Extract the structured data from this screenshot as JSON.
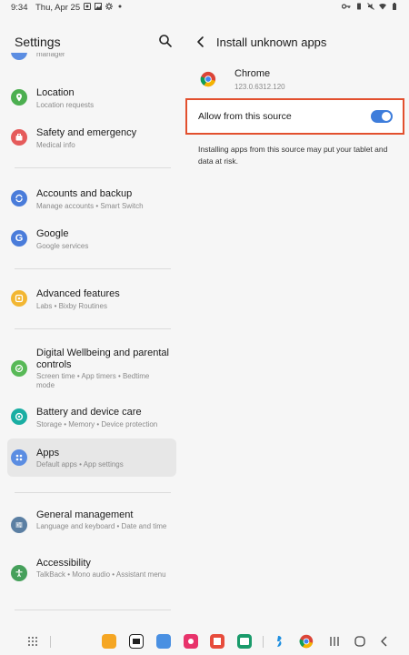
{
  "status_bar": {
    "time": "9:34",
    "date": "Thu, Apr 25"
  },
  "left": {
    "title": "Settings",
    "top_partial_sub": "manager",
    "items": [
      {
        "title": "Location",
        "sub": "Location requests",
        "icon": "location-icon",
        "color": "#4caf50"
      },
      {
        "title": "Safety and emergency",
        "sub": "Medical info",
        "icon": "safety-icon",
        "color": "#e55b5b"
      },
      {
        "title": "Accounts and backup",
        "sub": "Manage accounts  •  Smart Switch",
        "icon": "sync-icon",
        "color": "#4a7cda"
      },
      {
        "title": "Google",
        "sub": "Google services",
        "icon": "google-icon",
        "color": "#4a7cda"
      },
      {
        "title": "Advanced features",
        "sub": "Labs  •  Bixby Routines",
        "icon": "advanced-features-icon",
        "color": "#f2b632"
      },
      {
        "title": "Digital Wellbeing and parental controls",
        "sub": "Screen time  •  App timers  •  Bedtime mode",
        "icon": "wellbeing-icon",
        "color": "#58b957"
      },
      {
        "title": "Battery and device care",
        "sub": "Storage  •  Memory  •  Device protection",
        "icon": "device-care-icon",
        "color": "#1aaea3"
      },
      {
        "title": "Apps",
        "sub": "Default apps  •  App settings",
        "icon": "apps-icon",
        "color": "#5b8de2"
      },
      {
        "title": "General management",
        "sub": "Language and keyboard  •  Date and time",
        "icon": "general-management-icon",
        "color": "#5b7fa3"
      },
      {
        "title": "Accessibility",
        "sub": "TalkBack  •  Mono audio  •  Assistant menu",
        "icon": "accessibility-icon",
        "color": "#46a05b"
      }
    ]
  },
  "right": {
    "title": "Install unknown apps",
    "app_name": "Chrome",
    "app_version": "123.0.6312.120",
    "allow_label": "Allow from this source",
    "allow_enabled": true,
    "warning": "Installing apps from this source may put your tablet and data at risk."
  },
  "colors": {
    "accent": "#3e7ddb",
    "highlight_border": "#e2502e"
  }
}
